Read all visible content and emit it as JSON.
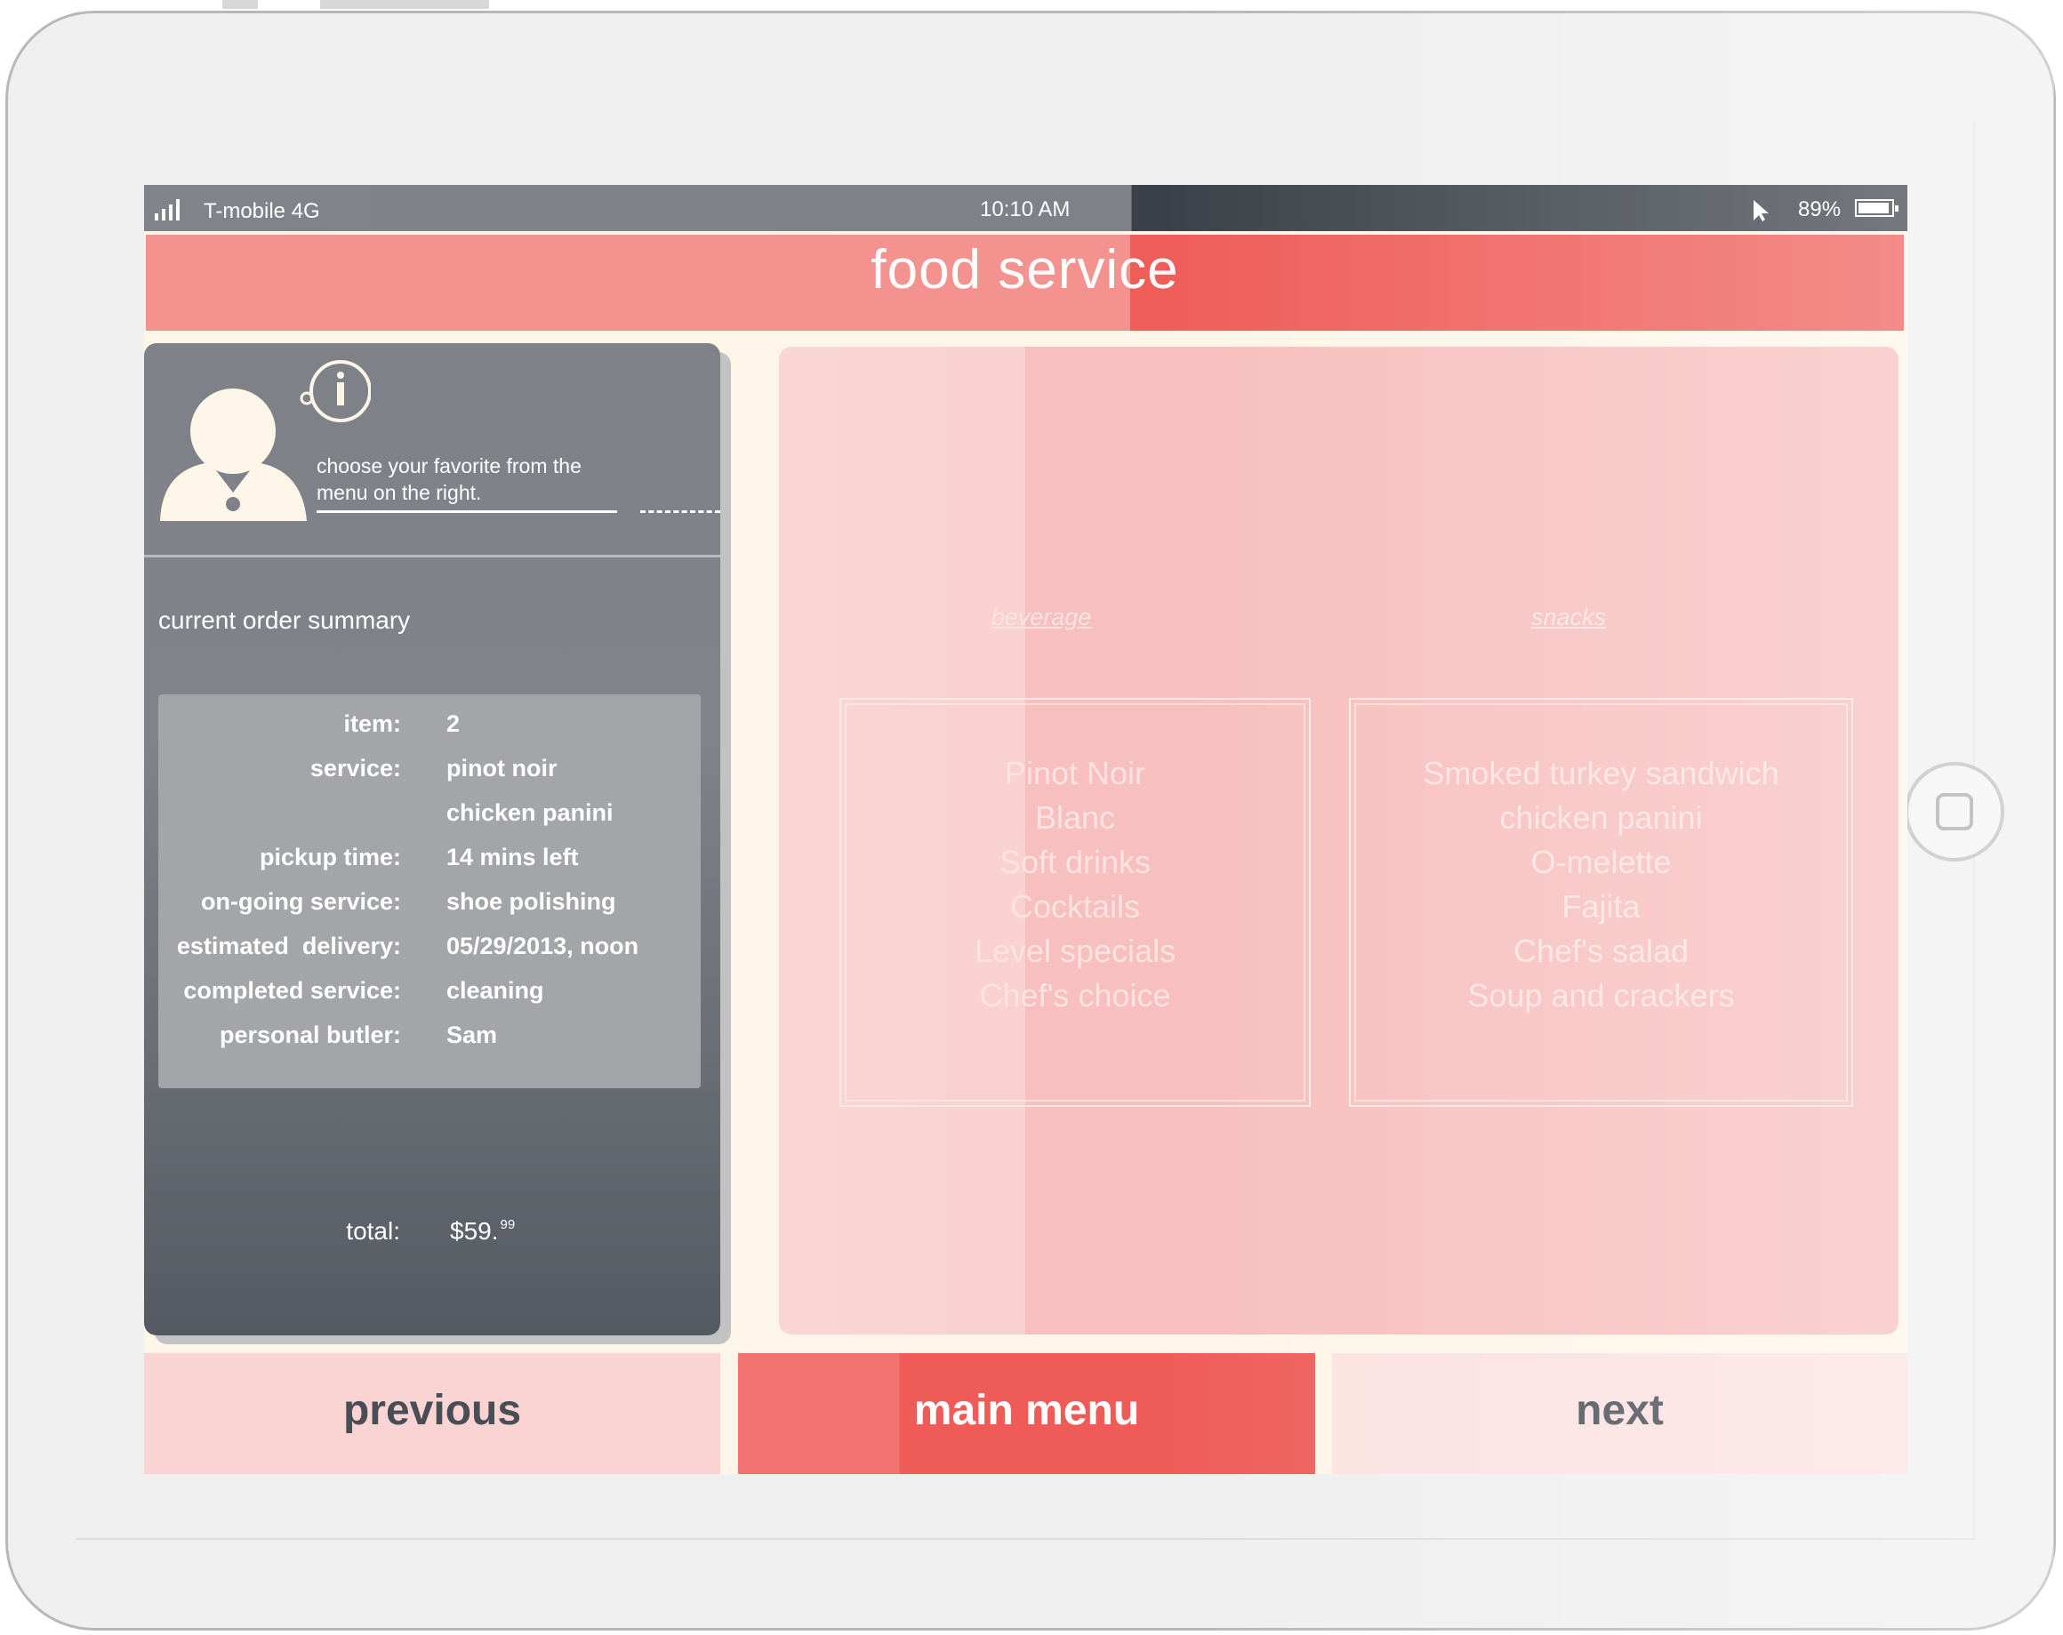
{
  "status_bar": {
    "carrier": "T-mobile 4G",
    "time": "10:10 AM",
    "battery": "89%",
    "icons": [
      "signal-icon",
      "cursor-icon",
      "battery-icon"
    ]
  },
  "header": {
    "title": "food service"
  },
  "assistant": {
    "prompt": "choose your favorite from the menu on the right.",
    "icons": [
      "avatar-icon",
      "info-icon"
    ]
  },
  "summary": {
    "label": "current order summary",
    "rows": [
      {
        "key": "item:",
        "value": "2"
      },
      {
        "key": "service:",
        "value": "pinot noir"
      },
      {
        "key": "",
        "value": "chicken panini"
      },
      {
        "key": "pickup time:",
        "value": "14 mins left"
      },
      {
        "key": "on-going service:",
        "value": "shoe polishing"
      },
      {
        "key": "estimated  delivery:",
        "value": "05/29/2013, noon"
      },
      {
        "key": "completed service:",
        "value": "cleaning"
      },
      {
        "key": "personal butler:",
        "value": "Sam"
      }
    ],
    "total_label": "total:",
    "total_value": "$59.",
    "total_cents": "99"
  },
  "menu": {
    "beverage": {
      "title": "beverage",
      "items": [
        "Pinot Noir",
        "Blanc",
        "Soft drinks",
        "Cocktails",
        "Level specials",
        "Chef's choice"
      ]
    },
    "snacks": {
      "title": "snacks",
      "items": [
        "Smoked turkey sandwich",
        "chicken panini",
        "O-melette",
        "Fajita",
        "Chef's salad",
        "Soup and crackers"
      ]
    }
  },
  "footer": {
    "previous": "previous",
    "main_menu": "main menu",
    "next": "next"
  },
  "colors": {
    "header_light": "#f4928f",
    "header_dark": "#ef5d59",
    "panel_gray": "#7e8187",
    "menu_pink": "#f7bfbd",
    "background_cream": "#fdf5e8"
  }
}
